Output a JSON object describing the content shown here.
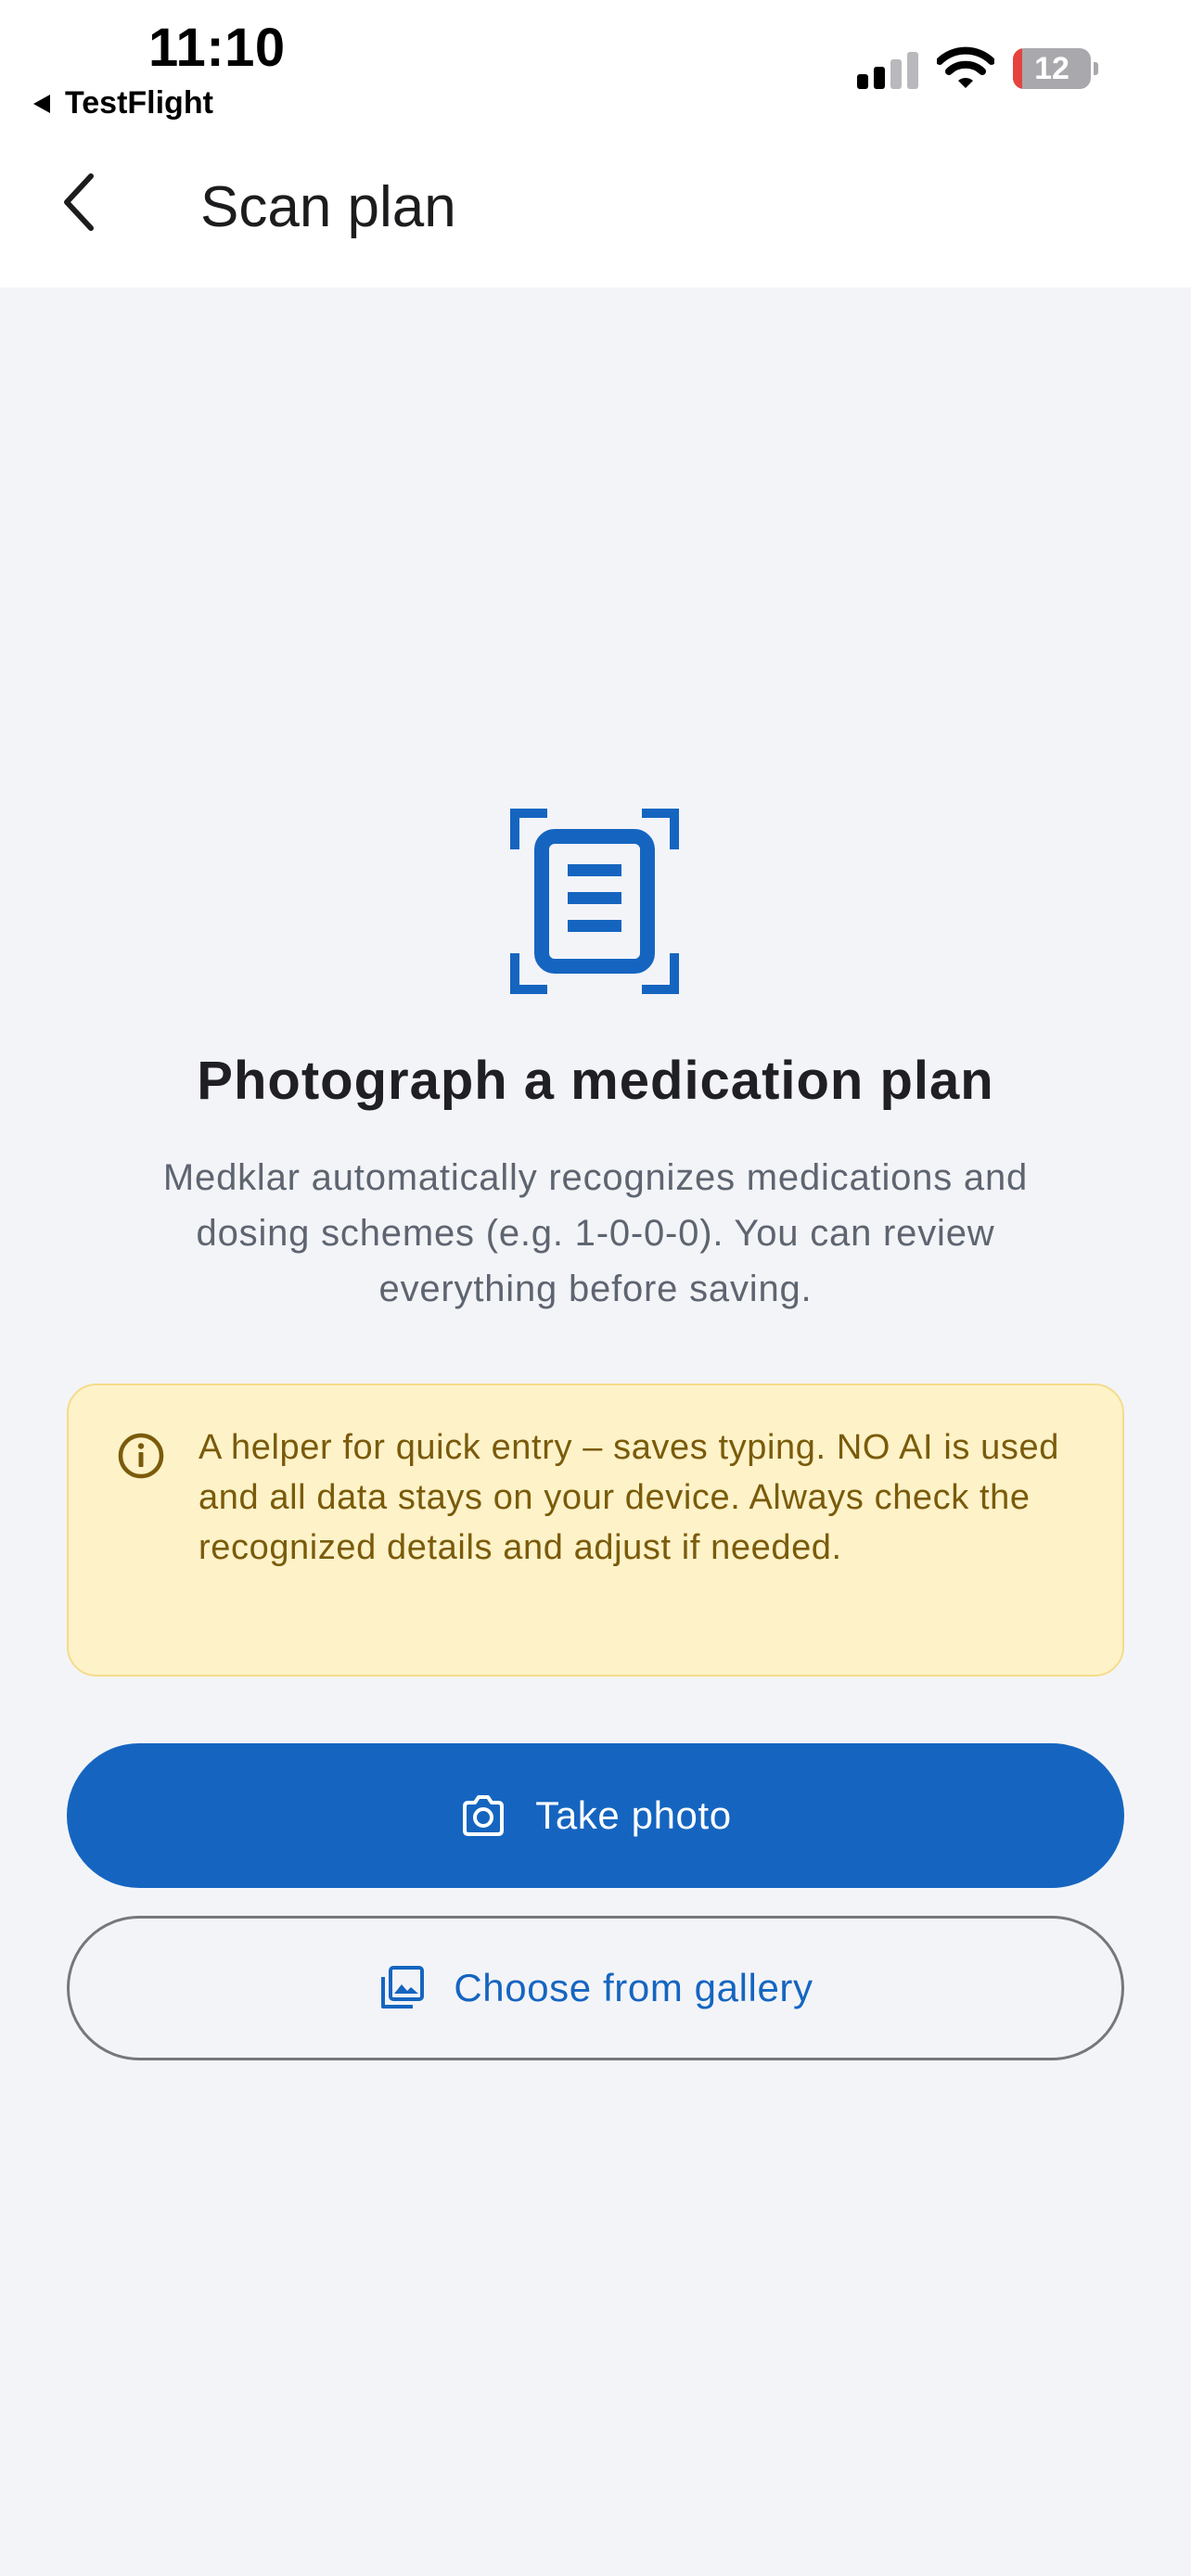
{
  "status_bar": {
    "time": "11:10",
    "back_app": "TestFlight",
    "battery_level": "12",
    "battery_fraction": 0.12,
    "signal_icon": "cellular-signal-icon",
    "wifi_icon": "wifi-icon"
  },
  "app_bar": {
    "title": "Scan plan",
    "back_icon": "back-arrow-icon"
  },
  "main": {
    "hero_icon": "document-scanner-icon",
    "headline": "Photograph a medication plan",
    "description": "Medklar automatically recognizes medications and dosing schemes (e.g. 1-0-0-0). You can review everything before saving.",
    "notice": {
      "icon": "info-icon",
      "text": "A helper for quick entry – saves typing. NO AI is used and all data stays on your device. Always check the recognized details and adjust if needed."
    },
    "primary_button": {
      "label": "Take photo",
      "icon": "camera-icon"
    },
    "secondary_button": {
      "label": "Choose from gallery",
      "icon": "gallery-icon"
    }
  },
  "colors": {
    "accent": "#1565c0",
    "background": "#f3f4f8",
    "notice_background": "#fef2c8",
    "notice_text": "#7a5b0b",
    "battery_low": "#e6433f"
  }
}
